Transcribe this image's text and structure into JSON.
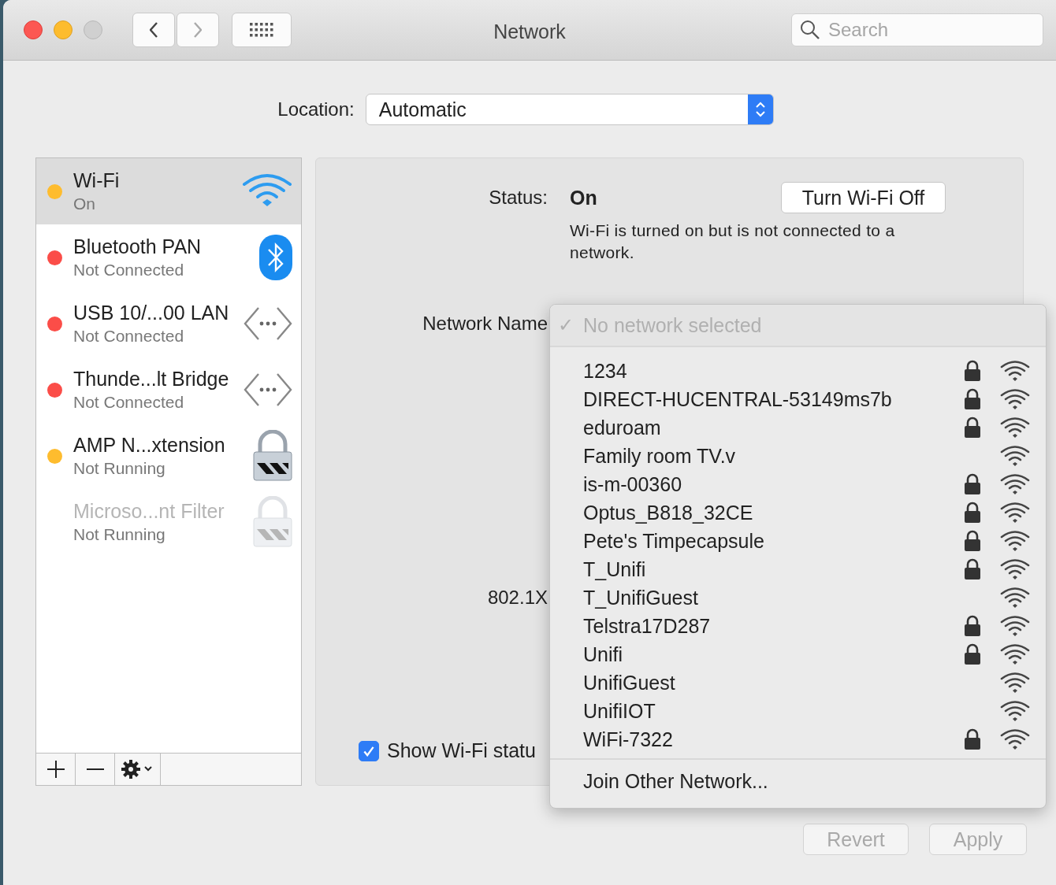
{
  "window": {
    "title": "Network",
    "search": {
      "placeholder": "Search"
    }
  },
  "location": {
    "label": "Location:",
    "value": "Automatic"
  },
  "services": [
    {
      "name": "Wi-Fi",
      "status": "On",
      "color": "#febc2e",
      "selected": true,
      "disabled": false,
      "kind": "wifi"
    },
    {
      "name": "Bluetooth PAN",
      "status": "Not Connected",
      "color": "#fb4d48",
      "selected": false,
      "disabled": false,
      "kind": "bluetooth"
    },
    {
      "name": "USB 10/...00 LAN",
      "status": "Not Connected",
      "color": "#fb4d48",
      "selected": false,
      "disabled": false,
      "kind": "ethernet"
    },
    {
      "name": "Thunde...lt Bridge",
      "status": "Not Connected",
      "color": "#fb4d48",
      "selected": false,
      "disabled": false,
      "kind": "ethernet"
    },
    {
      "name": "AMP N...xtension",
      "status": "Not Running",
      "color": "#febc2e",
      "selected": false,
      "disabled": false,
      "kind": "vpn"
    },
    {
      "name": "Microso...nt Filter",
      "status": "Not Running",
      "selected": false,
      "disabled": true,
      "kind": "vpn"
    }
  ],
  "status": {
    "label": "Status:",
    "value": "On",
    "button": "Turn Wi-Fi Off",
    "description": "Wi-Fi is turned on but is not connected to a network."
  },
  "network_name": {
    "label": "Network Name"
  },
  "dot1x": {
    "label": "802.1X"
  },
  "show_status": {
    "label": "Show Wi-Fi statu",
    "checked": true
  },
  "network_menu": {
    "check": "✓",
    "header": "No network selected",
    "networks": [
      {
        "name": "1234",
        "locked": true
      },
      {
        "name": "DIRECT-HUCENTRAL-53149ms7b",
        "locked": true
      },
      {
        "name": "eduroam",
        "locked": true
      },
      {
        "name": "Family room TV.v",
        "locked": false
      },
      {
        "name": "is-m-00360",
        "locked": true
      },
      {
        "name": "Optus_B818_32CE",
        "locked": true
      },
      {
        "name": "Pete's Timpecapsule",
        "locked": true
      },
      {
        "name": "T_Unifi",
        "locked": true
      },
      {
        "name": "T_UnifiGuest",
        "locked": false
      },
      {
        "name": "Telstra17D287",
        "locked": true
      },
      {
        "name": "Unifi",
        "locked": true
      },
      {
        "name": "UnifiGuest",
        "locked": false
      },
      {
        "name": "UnifiIOT",
        "locked": false
      },
      {
        "name": "WiFi-7322",
        "locked": true
      }
    ],
    "join": "Join Other Network..."
  },
  "buttons": [
    "Revert",
    "Apply"
  ]
}
